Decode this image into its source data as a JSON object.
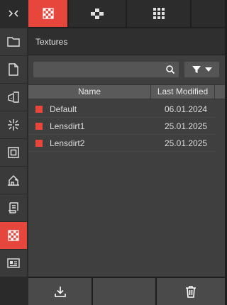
{
  "sidebar": {
    "collapse_icon": "collapse-icon",
    "items": [
      {
        "icon": "folder-icon"
      },
      {
        "icon": "document-icon"
      },
      {
        "icon": "door-exit-icon"
      },
      {
        "icon": "light-burst-icon"
      },
      {
        "icon": "frame-icon"
      },
      {
        "icon": "house-landscape-icon"
      },
      {
        "icon": "script-icon"
      },
      {
        "icon": "checker-texture-icon",
        "active": true
      },
      {
        "icon": "id-card-icon"
      }
    ]
  },
  "tabs": [
    {
      "icon": "checker-texture-icon",
      "active": true
    },
    {
      "icon": "node-graph-icon",
      "active": false
    },
    {
      "icon": "grid-icon",
      "active": false
    }
  ],
  "panel": {
    "title": "Textures"
  },
  "search": {
    "placeholder": "",
    "value": ""
  },
  "table": {
    "columns": [
      "Name",
      "Last Modified"
    ],
    "rows": [
      {
        "name": "Default",
        "date": "06.01.2024"
      },
      {
        "name": "Lensdirt1",
        "date": "25.01.2025"
      },
      {
        "name": "Lensdirt2",
        "date": "25.01.2025"
      }
    ]
  },
  "bottom": {
    "import_icon": "import-icon",
    "delete_icon": "trash-icon"
  },
  "colors": {
    "accent": "#e6463b",
    "panel": "#3f3f3f",
    "header": "#5a5a5a"
  }
}
